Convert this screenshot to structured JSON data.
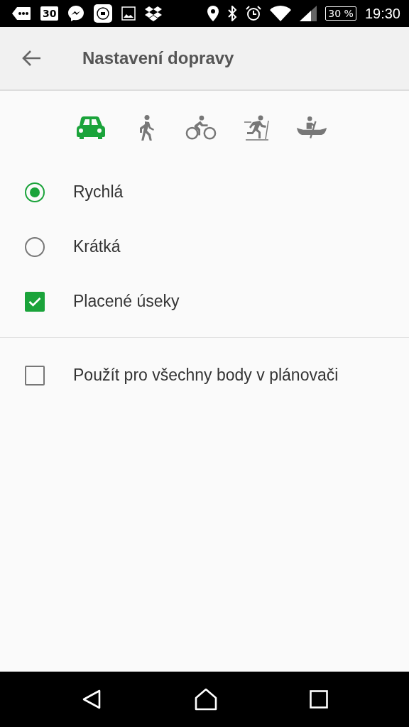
{
  "status_bar": {
    "calendar_day": "30",
    "battery": "30 %",
    "time": "19:30"
  },
  "app_bar": {
    "title": "Nastavení dopravy"
  },
  "modes": [
    {
      "kind": "car",
      "selected": true
    },
    {
      "kind": "walk",
      "selected": false
    },
    {
      "kind": "bike",
      "selected": false
    },
    {
      "kind": "ski",
      "selected": false
    },
    {
      "kind": "canoe",
      "selected": false
    }
  ],
  "route_options": [
    {
      "kind": "radio",
      "label": "Rychlá",
      "checked": true
    },
    {
      "kind": "radio",
      "label": "Krátká",
      "checked": false
    },
    {
      "kind": "checkbox",
      "label": "Placené úseky",
      "checked": true
    }
  ],
  "planner_options": [
    {
      "kind": "checkbox",
      "label": "Použít pro všechny body v plánovači",
      "checked": false
    }
  ]
}
